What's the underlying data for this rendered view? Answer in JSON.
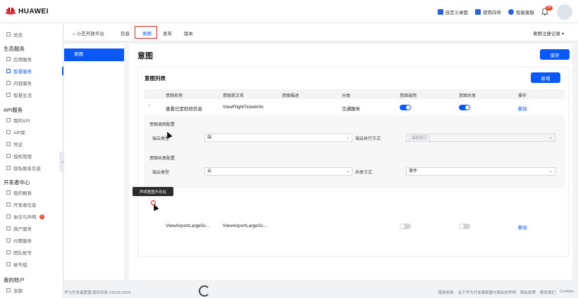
{
  "brand": {
    "name": "HUAWEI",
    "color": "#c7000b"
  },
  "topbar": {
    "links": [
      "自定义桌面",
      "使用向导",
      "智能客服"
    ],
    "notification_count": "20"
  },
  "sidebar": {
    "items": [
      {
        "label": "总览",
        "type": "item"
      },
      {
        "label": "生态服务",
        "type": "group"
      },
      {
        "label": "应用服务",
        "type": "item"
      },
      {
        "label": "智慧服务",
        "type": "item",
        "active": true
      },
      {
        "label": "内容服务",
        "type": "item"
      },
      {
        "label": "智慧生活",
        "type": "item"
      },
      {
        "label": "API服务",
        "type": "group"
      },
      {
        "label": "我的API",
        "type": "item"
      },
      {
        "label": "API库",
        "type": "item"
      },
      {
        "label": "凭证",
        "type": "item"
      },
      {
        "label": "授权管理",
        "type": "item"
      },
      {
        "label": "隐私联系信息",
        "type": "item"
      },
      {
        "label": "开发者中心",
        "type": "group"
      },
      {
        "label": "我的报表",
        "type": "item"
      },
      {
        "label": "开发者信息",
        "type": "item"
      },
      {
        "label": "协议与声明",
        "type": "item",
        "badge": "5"
      },
      {
        "label": "商户服务",
        "type": "item"
      },
      {
        "label": "付费服务",
        "type": "item"
      },
      {
        "label": "团队帐号",
        "type": "item"
      },
      {
        "label": "帐号组",
        "type": "item"
      },
      {
        "label": "我的账户",
        "type": "group"
      },
      {
        "label": "余额",
        "type": "item"
      }
    ]
  },
  "subnav": {
    "home": "小艺开放平台",
    "tabs": [
      "信息",
      "意图",
      "发布",
      "版本"
    ],
    "active": "意图",
    "right_menu": "意图注册记录"
  },
  "left_panel": {
    "item": "意图"
  },
  "main": {
    "title": "意图",
    "save_label": "保存",
    "card": {
      "title": "意图列表",
      "new_label": "新增",
      "columns": [
        "意图名称",
        "意图英文名",
        "意图描述",
        "分类",
        "意图调用",
        "意图共享",
        "操作"
      ],
      "rows": [
        {
          "name": "查看已定航班信息",
          "en_name": "ViewFlightTicketInfo",
          "desc": "",
          "category": "交通服务",
          "call": true,
          "share": true,
          "action": "删除"
        },
        {
          "name": "ViewAirportLargeSc...",
          "en_name": "ViewAirportLargeSc...",
          "desc": "",
          "category": "",
          "call": false,
          "share": false,
          "action": "删除"
        }
      ],
      "detail": {
        "call_section": "意图调用配置",
        "call_type_label": "端云类型",
        "call_type_value": "端",
        "exec_label": "端云执行方式",
        "exec_value": "端侧执行",
        "share_section": "意图共享配置",
        "share_type_label": "端云类型",
        "share_type_value": "云",
        "share_mode_label": "共享方式",
        "share_mode_value": "事件"
      }
    },
    "tooltip": "声明意图不存在"
  },
  "footer": {
    "copyright": "华为开发者联盟 版权所有 ©2018-2024",
    "links": [
      "使用条款",
      "关于华为开发者联盟与隐私的声明",
      "隐私政策",
      "联系我们",
      "Cookies"
    ]
  }
}
